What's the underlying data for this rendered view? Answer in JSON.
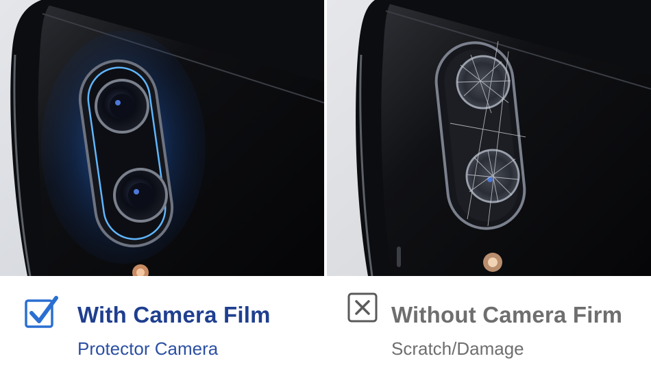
{
  "left": {
    "status_icon": "checkbox-checked-icon",
    "title": "With Camera Film",
    "subtitle": "Protector Camera",
    "accent_color": "#1f3f8f"
  },
  "right": {
    "status_icon": "close-box-icon",
    "title": "Without Camera Firm",
    "subtitle": "Scratch/Damage",
    "text_color": "#6e6e6e"
  }
}
